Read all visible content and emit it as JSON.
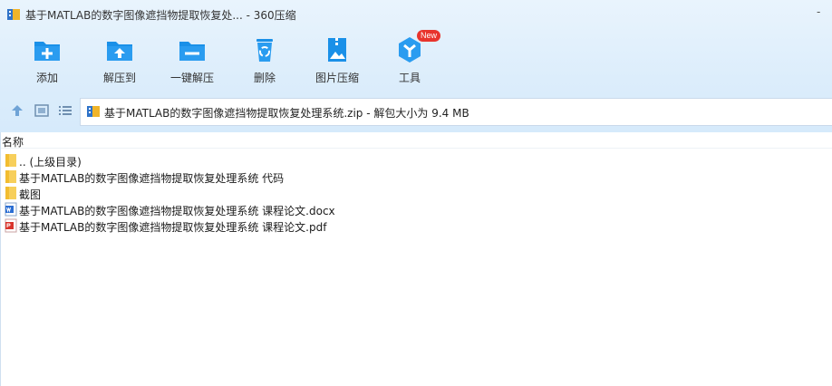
{
  "window": {
    "title": "基于MATLAB的数字图像遮挡物提取恢复处... - 360压缩",
    "control": "-"
  },
  "toolbar": [
    {
      "label": "添加",
      "icon": "add-folder-icon"
    },
    {
      "label": "解压到",
      "icon": "extract-folder-icon"
    },
    {
      "label": "一键解压",
      "icon": "one-click-extract-icon"
    },
    {
      "label": "删除",
      "icon": "recycle-bin-icon"
    },
    {
      "label": "图片压缩",
      "icon": "image-compress-icon"
    },
    {
      "label": "工具",
      "icon": "tools-icon",
      "badge": "New"
    }
  ],
  "nav": {
    "up_icon": "up-arrow-icon",
    "view_icon": "thumbnail-view-icon",
    "list_icon": "list-view-icon",
    "path": "基于MATLAB的数字图像遮挡物提取恢复处理系统.zip - 解包大小为 9.4 MB",
    "path_icon": "zip-archive-icon"
  },
  "list": {
    "column_name": "名称",
    "rows": [
      {
        "name": ".. (上级目录)",
        "icon": "folder-icon"
      },
      {
        "name": "基于MATLAB的数字图像遮挡物提取恢复处理系统 代码",
        "icon": "folder-icon"
      },
      {
        "name": "截图",
        "icon": "folder-icon"
      },
      {
        "name": "基于MATLAB的数字图像遮挡物提取恢复处理系统 课程论文.docx",
        "icon": "word-file-icon"
      },
      {
        "name": "基于MATLAB的数字图像遮挡物提取恢复处理系统 课程论文.pdf",
        "icon": "pdf-file-icon"
      }
    ]
  },
  "colors": {
    "accent": "#1a90e8",
    "toolbar_bg": "#dcedfb",
    "badge": "#e8342d"
  }
}
